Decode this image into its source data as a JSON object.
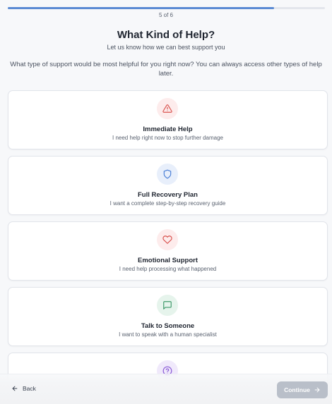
{
  "progress": {
    "step_label": "5 of 6",
    "fraction": 0.84,
    "color": "#5b8bd4"
  },
  "header": {
    "title": "What Kind of Help?",
    "subtitle": "Let us know how we can best support you",
    "prompt": "What type of support would be most helpful for you right now? You can always access other types of help later."
  },
  "options": [
    {
      "icon": "warning-triangle-icon",
      "title": "Immediate Help",
      "description": "I need help right now to stop further damage",
      "icon_color": "#d9534f",
      "icon_bg": "#fdecec"
    },
    {
      "icon": "shield-icon",
      "title": "Full Recovery Plan",
      "description": "I want a complete step-by-step recovery guide",
      "icon_color": "#4a7fd6",
      "icon_bg": "#e8effb"
    },
    {
      "icon": "heart-icon",
      "title": "Emotional Support",
      "description": "I need help processing what happened",
      "icon_color": "#d9534f",
      "icon_bg": "#fdecec"
    },
    {
      "icon": "chat-bubble-icon",
      "title": "Talk to Someone",
      "description": "I want to speak with a human specialist",
      "icon_color": "#3f9a6a",
      "icon_bg": "#e6f4ec"
    },
    {
      "icon": "question-circle-icon",
      "title": "",
      "description": "",
      "icon_color": "#8a5bd6",
      "icon_bg": "#f0e9fb"
    }
  ],
  "footer": {
    "back_label": "Back",
    "continue_label": "Continue"
  }
}
